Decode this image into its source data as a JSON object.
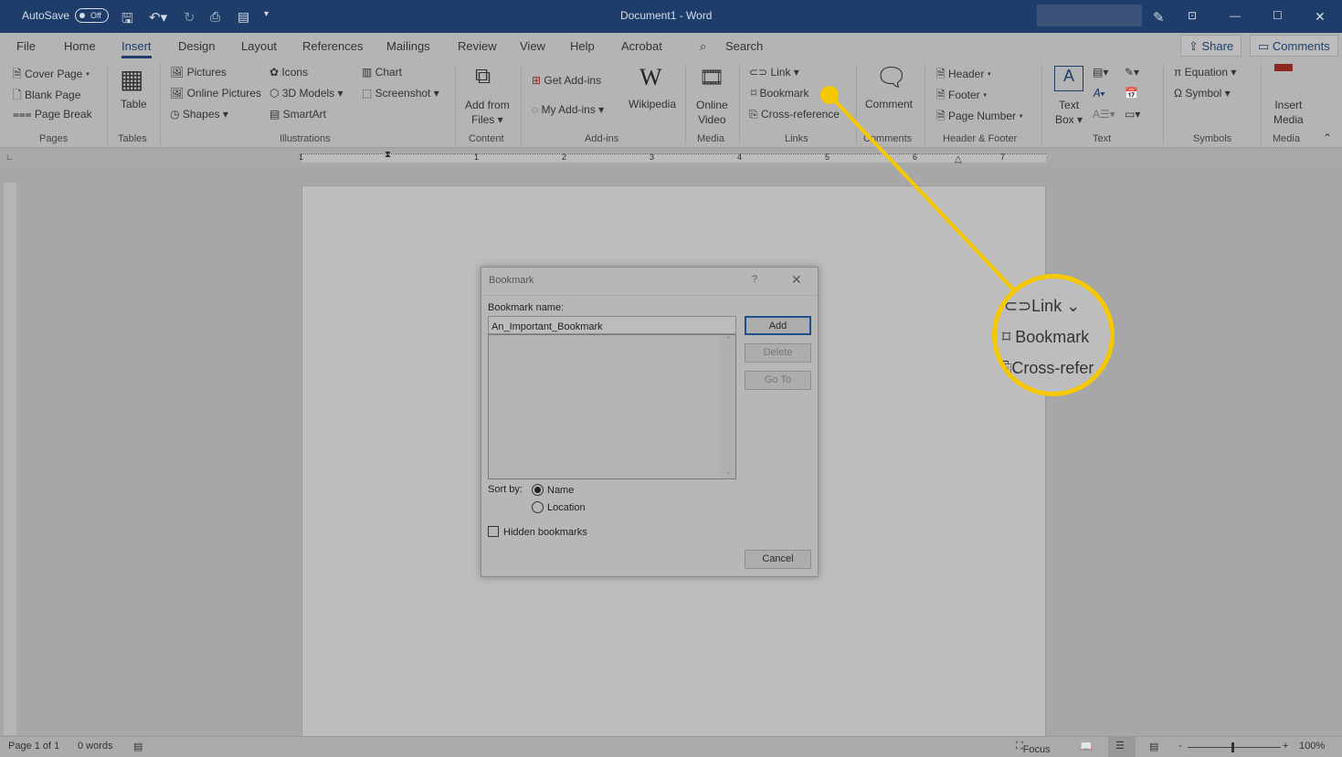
{
  "titlebar": {
    "autosave": "AutoSave",
    "autosave_state": "Off",
    "title": "Document1  -  Word"
  },
  "tabs": [
    "File",
    "Home",
    "Insert",
    "Design",
    "Layout",
    "References",
    "Mailings",
    "Review",
    "View",
    "Help",
    "Acrobat"
  ],
  "active_tab": "Insert",
  "search": "Search",
  "share": "Share",
  "comments": "Comments",
  "ribbon": {
    "pages": {
      "label": "Pages",
      "items": [
        "Cover Page",
        "Blank Page",
        "Page Break"
      ]
    },
    "tables": {
      "label": "Tables",
      "items": [
        "Table"
      ]
    },
    "illustrations": {
      "label": "Illustrations",
      "items": [
        "Pictures",
        "Online Pictures",
        "Shapes",
        "Icons",
        "3D Models",
        "SmartArt",
        "Chart",
        "Screenshot"
      ]
    },
    "content": {
      "label": "Content",
      "items": [
        "Add from",
        "Files"
      ]
    },
    "addins": {
      "label": "Add-ins",
      "items": [
        "Get Add-ins",
        "My Add-ins",
        "Wikipedia"
      ]
    },
    "media": {
      "label": "Media",
      "items": [
        "Online",
        "Video"
      ]
    },
    "links": {
      "label": "Links",
      "items": [
        "Link",
        "Bookmark",
        "Cross-reference"
      ]
    },
    "comments": {
      "label": "Comments",
      "items": [
        "Comment"
      ]
    },
    "header_footer": {
      "label": "Header & Footer",
      "items": [
        "Header",
        "Footer",
        "Page Number"
      ]
    },
    "text": {
      "label": "Text",
      "items": [
        "Text",
        "Box"
      ]
    },
    "symbols": {
      "label": "Symbols",
      "items": [
        "Equation",
        "Symbol"
      ]
    },
    "media2": {
      "label": "Media",
      "items": [
        "Insert",
        "Media"
      ]
    }
  },
  "ruler_numbers": [
    "1",
    "1",
    "2",
    "3",
    "4",
    "5",
    "6",
    "7"
  ],
  "dialog": {
    "title": "Bookmark",
    "help": "?",
    "name_label": "Bookmark name:",
    "name_value": "An_Important_Bookmark",
    "add": "Add",
    "delete": "Delete",
    "goto": "Go To",
    "sort_by": "Sort by:",
    "sort_name": "Name",
    "sort_location": "Location",
    "sort_selected": "Name",
    "hidden": "Hidden bookmarks",
    "hidden_checked": false,
    "cancel": "Cancel"
  },
  "callout": {
    "items": [
      "Link",
      "Bookmark",
      "Cross-refer"
    ],
    "color": "#f5c800"
  },
  "status": {
    "page": "Page 1 of 1",
    "words": "0 words",
    "focus": "Focus",
    "zoom": "100%"
  }
}
